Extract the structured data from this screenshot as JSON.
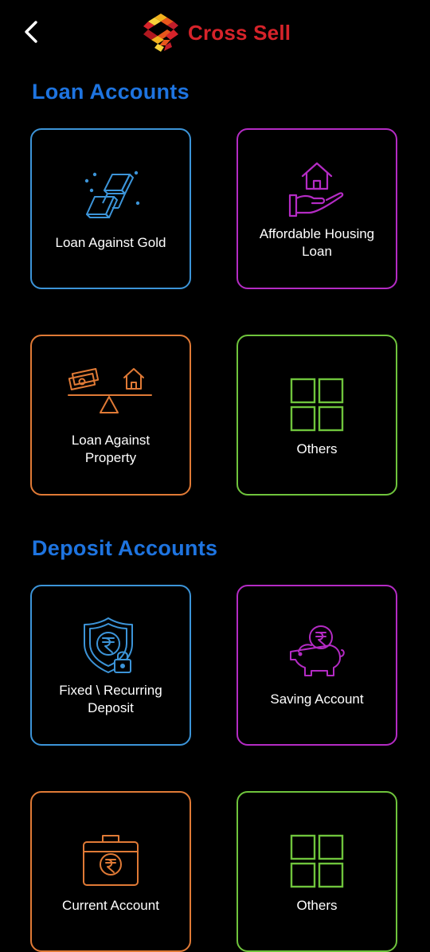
{
  "header": {
    "title": "Cross Sell",
    "back_icon": "chevron-left-icon",
    "logo_icon": "cross-sell-logo"
  },
  "colors": {
    "brand_red": "#d6232a",
    "section_blue": "#1e74e0",
    "blue": "#3c94d8",
    "purple": "#b42bc4",
    "orange": "#e07a36",
    "green": "#6fc43c"
  },
  "sections": [
    {
      "title": "Loan Accounts",
      "cards": [
        {
          "label": "Loan Against  Gold",
          "icon": "gold-bars-icon",
          "color": "blue"
        },
        {
          "label": "Affordable Housing\nLoan",
          "icon": "house-in-hand-icon",
          "color": "purple"
        },
        {
          "label": "Loan Against\nProperty",
          "icon": "money-house-balance-icon",
          "color": "orange"
        },
        {
          "label": "Others",
          "icon": "grid-icon",
          "color": "green"
        }
      ]
    },
    {
      "title": "Deposit Accounts",
      "cards": [
        {
          "label": "Fixed \\ Recurring\nDeposit",
          "icon": "rupee-shield-lock-icon",
          "color": "blue"
        },
        {
          "label": "Saving Account",
          "icon": "piggy-bank-icon",
          "color": "purple"
        },
        {
          "label": "Current Account",
          "icon": "rupee-briefcase-icon",
          "color": "orange"
        },
        {
          "label": "Others",
          "icon": "grid-icon",
          "color": "green"
        }
      ]
    }
  ]
}
